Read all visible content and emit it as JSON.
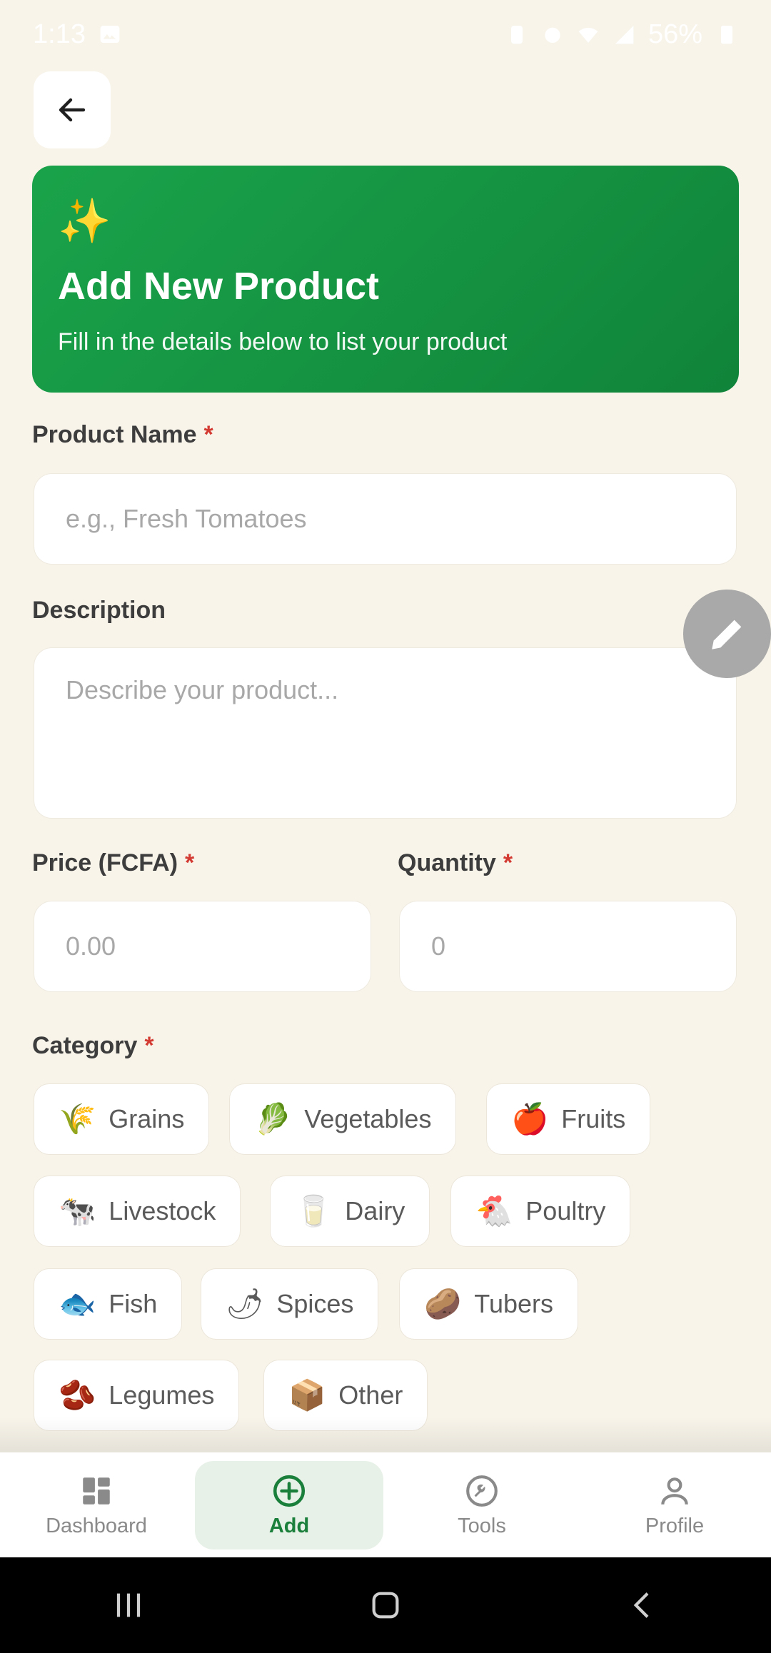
{
  "status_bar": {
    "time": "1:13",
    "battery": "56%"
  },
  "header": {
    "sparkle": "✨",
    "title": "Add New Product",
    "subtitle": "Fill in the details below to list your product"
  },
  "form": {
    "product_name": {
      "label": "Product Name",
      "required_mark": "*",
      "placeholder": "e.g., Fresh Tomatoes"
    },
    "description": {
      "label": "Description",
      "placeholder": "Describe your product..."
    },
    "price": {
      "label": "Price (FCFA)",
      "required_mark": "*",
      "placeholder": "0.00"
    },
    "quantity": {
      "label": "Quantity",
      "required_mark": "*",
      "placeholder": "0"
    },
    "category": {
      "label": "Category",
      "required_mark": "*",
      "options": [
        {
          "emoji": "🌾",
          "label": "Grains"
        },
        {
          "emoji": "🥬",
          "label": "Vegetables"
        },
        {
          "emoji": "🍎",
          "label": "Fruits"
        },
        {
          "emoji": "🐄",
          "label": "Livestock"
        },
        {
          "emoji": "🥛",
          "label": "Dairy"
        },
        {
          "emoji": "🐔",
          "label": "Poultry"
        },
        {
          "emoji": "🐟",
          "label": "Fish"
        },
        {
          "emoji": "🌶",
          "label": "Spices"
        },
        {
          "emoji": "🥔",
          "label": "Tubers"
        },
        {
          "emoji": "🫘",
          "label": "Legumes"
        },
        {
          "emoji": "📦",
          "label": "Other"
        }
      ]
    }
  },
  "bottom_nav": {
    "items": [
      {
        "label": "Dashboard",
        "icon": "dashboard-icon"
      },
      {
        "label": "Add",
        "icon": "add-circle-icon",
        "active": true
      },
      {
        "label": "Tools",
        "icon": "tools-icon"
      },
      {
        "label": "Profile",
        "icon": "profile-icon"
      }
    ]
  },
  "colors": {
    "background": "#f8f4ea",
    "accent": "#10843a",
    "required": "#d33a32"
  }
}
